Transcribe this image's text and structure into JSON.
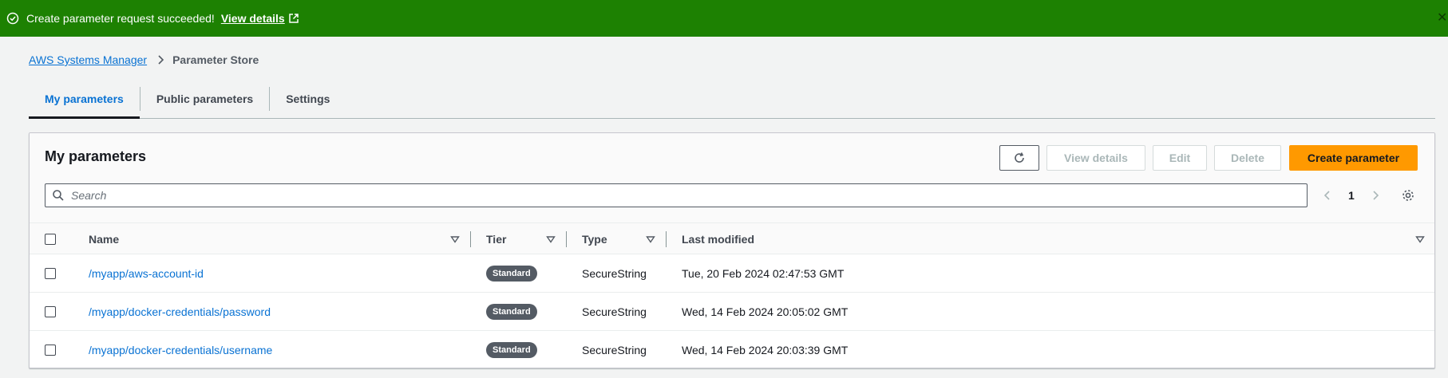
{
  "flash": {
    "message": "Create parameter request succeeded!",
    "link_label": "View details",
    "background": "#1d8102"
  },
  "breadcrumb": {
    "items": [
      "AWS Systems Manager",
      "Parameter Store"
    ]
  },
  "tabs": [
    {
      "label": "My parameters",
      "active": true
    },
    {
      "label": "Public parameters",
      "active": false
    },
    {
      "label": "Settings",
      "active": false
    }
  ],
  "panel": {
    "title": "My parameters",
    "buttons": {
      "view_details": "View details",
      "edit": "Edit",
      "delete": "Delete",
      "create": "Create parameter"
    },
    "search_placeholder": "Search",
    "page": "1"
  },
  "table": {
    "columns": [
      "Name",
      "Tier",
      "Type",
      "Last modified"
    ],
    "rows": [
      {
        "name": "/myapp/aws-account-id",
        "tier": "Standard",
        "type": "SecureString",
        "last_modified": "Tue, 20 Feb 2024 02:47:53 GMT"
      },
      {
        "name": "/myapp/docker-credentials/password",
        "tier": "Standard",
        "type": "SecureString",
        "last_modified": "Wed, 14 Feb 2024 20:05:02 GMT"
      },
      {
        "name": "/myapp/docker-credentials/username",
        "tier": "Standard",
        "type": "SecureString",
        "last_modified": "Wed, 14 Feb 2024 20:03:39 GMT"
      }
    ]
  },
  "colors": {
    "link": "#0972d3",
    "primary_button": "#ff9900",
    "badge": "#545b64"
  }
}
